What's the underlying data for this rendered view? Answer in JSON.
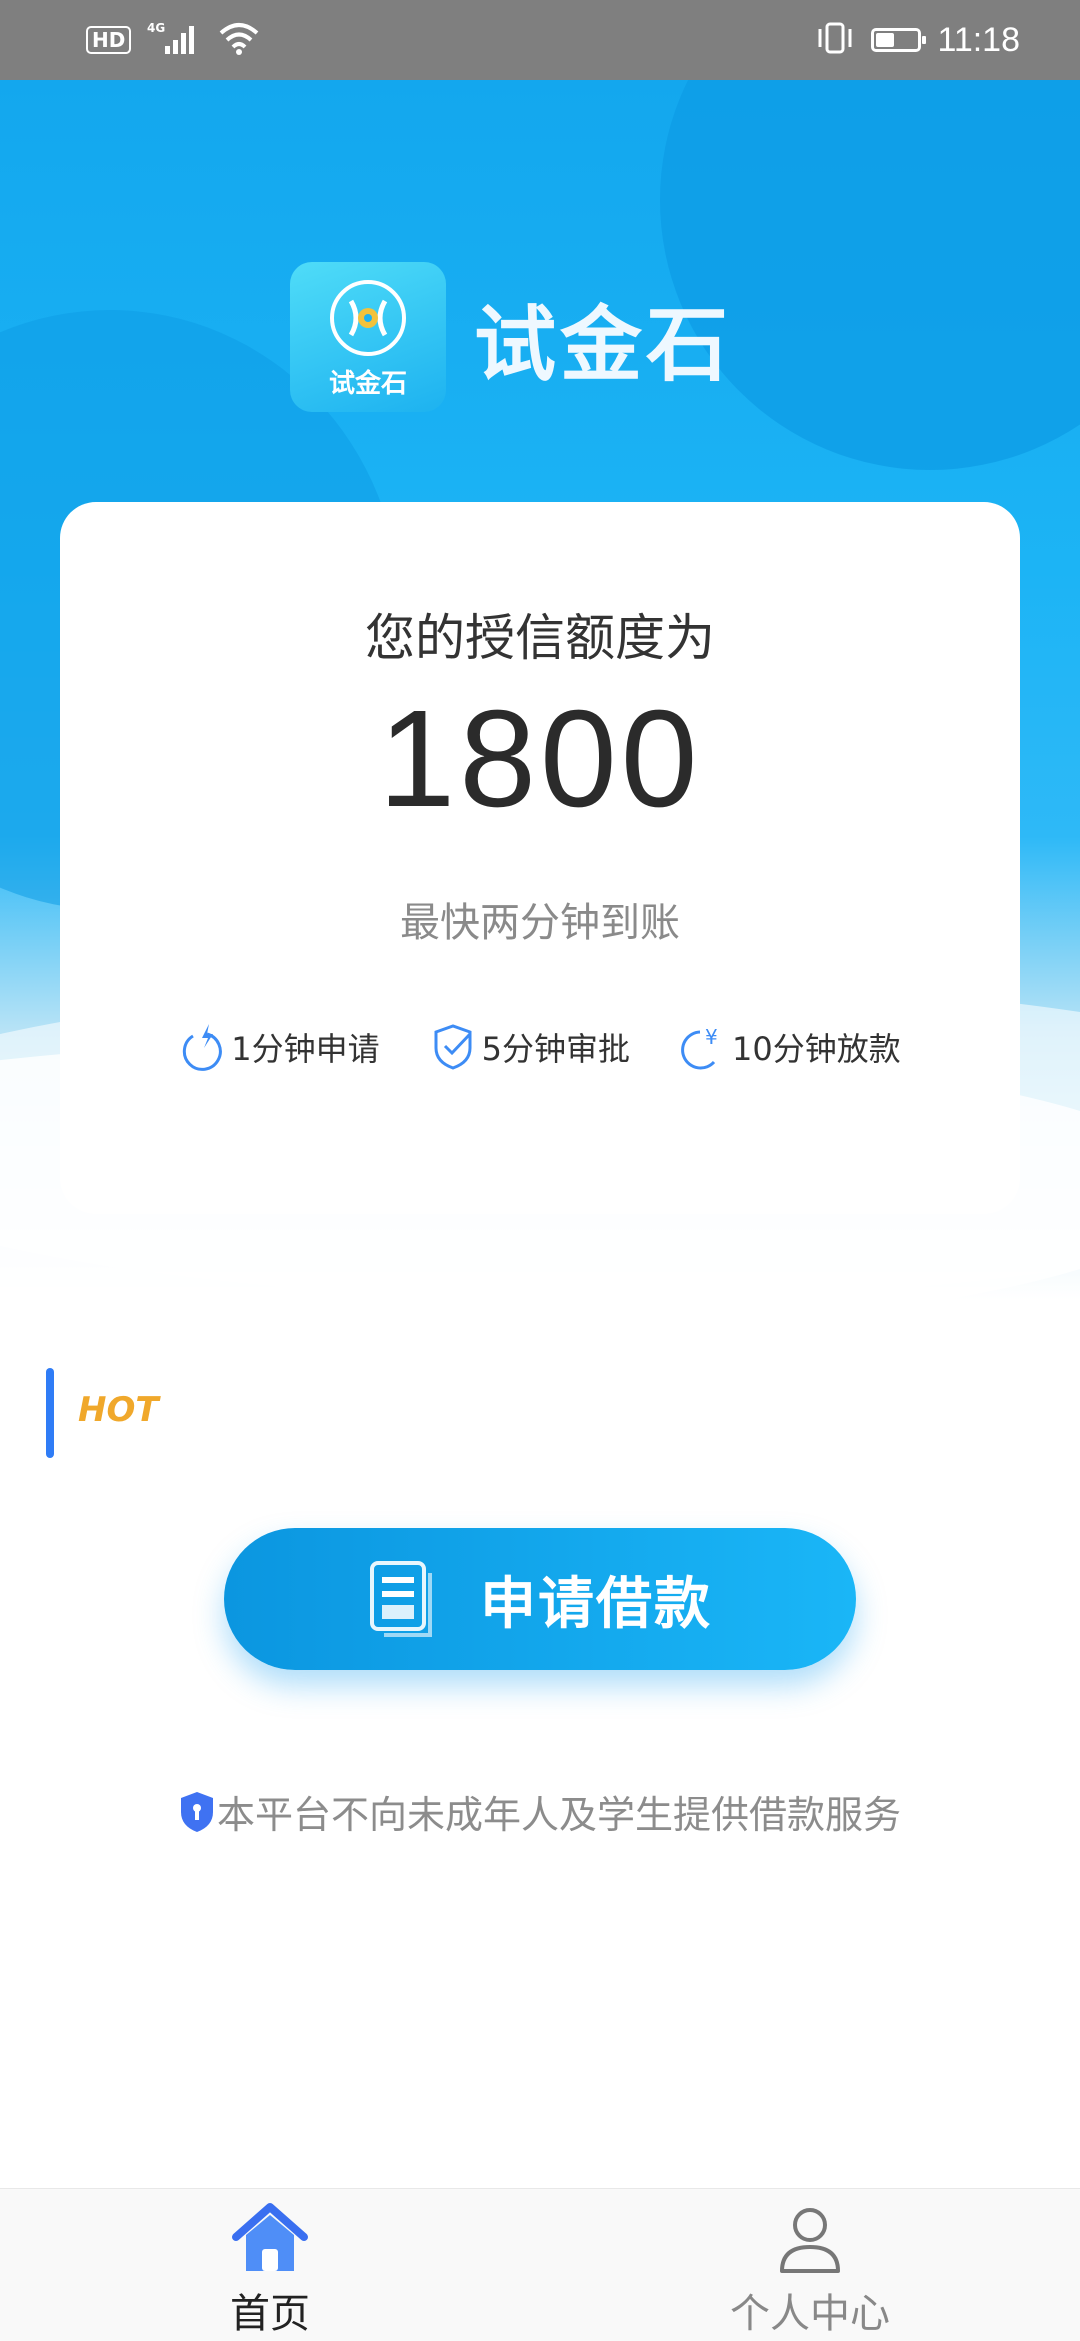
{
  "status_bar": {
    "network_badge": "HD",
    "signal_type": "4G",
    "time": "11:18",
    "icons": [
      "hd-icon",
      "signal-icon",
      "wifi-icon",
      "vibrate-icon",
      "battery-icon"
    ]
  },
  "brand": {
    "logo_text": "试金石",
    "name": "试金石"
  },
  "credit_card": {
    "label": "您的授信额度为",
    "amount": "1800",
    "subtitle": "最快两分钟到账",
    "features": [
      {
        "icon": "lightning-timer-icon",
        "label": "1分钟申请"
      },
      {
        "icon": "shield-check-icon",
        "label": "5分钟审批"
      },
      {
        "icon": "yen-timer-icon",
        "label": "10分钟放款"
      }
    ]
  },
  "hot_section": {
    "label": "HOT"
  },
  "apply_button": {
    "label": "申请借款",
    "icon": "document-icon"
  },
  "notice": {
    "text": "本平台不向未成年人及学生提供借款服务",
    "icon": "shield-lock-icon"
  },
  "bottom_nav": {
    "items": [
      {
        "label": "首页",
        "icon": "home-icon",
        "active": true
      },
      {
        "label": "个人中心",
        "icon": "person-icon",
        "active": false
      }
    ]
  },
  "colors": {
    "primary": "#13a7ee",
    "button_start": "#0b96e0",
    "button_end": "#1ab6f7",
    "hot": "#f0a82b",
    "hot_bar": "#2f7cf6",
    "nav_active": "#3a6ff0"
  }
}
